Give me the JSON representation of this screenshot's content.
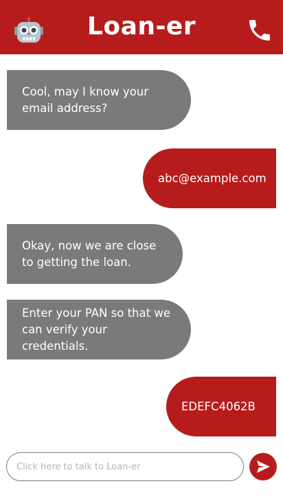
{
  "header": {
    "title": "Loan-er",
    "bot_avatar_icon": "robot-face-icon",
    "call_icon": "phone-icon",
    "background_color": "#b71c1c"
  },
  "messages": [
    {
      "sender": "bot",
      "text": "Cool, may I know your email address?"
    },
    {
      "sender": "user",
      "text": "abc@example.com"
    },
    {
      "sender": "bot",
      "text": "Okay, now we are close to getting the loan."
    },
    {
      "sender": "bot",
      "text": "Enter your PAN so that we can verify your credentials."
    },
    {
      "sender": "user",
      "text": "EDEFC4062B"
    }
  ],
  "composer": {
    "placeholder": "Click here to talk to Loan-er",
    "value": "",
    "send_icon": "send-icon"
  },
  "colors": {
    "accent": "#b71c1c",
    "bot_bubble": "#7a7a7a",
    "background": "#ffffff"
  }
}
